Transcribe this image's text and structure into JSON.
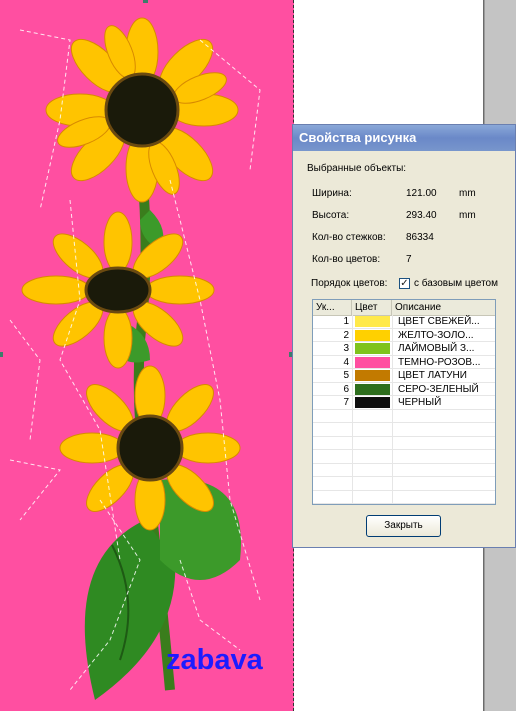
{
  "watermark": "zabava",
  "dialog": {
    "title": "Свойства рисунка",
    "selected_objects_label": "Выбранные объекты:",
    "width_label": "Ширина:",
    "width_value": "121.00",
    "width_unit": "mm",
    "height_label": "Высота:",
    "height_value": "293.40",
    "height_unit": "mm",
    "stitches_label": "Кол-во стежков:",
    "stitches_value": "86334",
    "colors_label": "Кол-во цветов:",
    "colors_value": "7",
    "order_label": "Порядок цветов:",
    "base_color_label": "с базовым цветом",
    "base_color_checked": "✓",
    "table": {
      "col_num": "Ук...",
      "col_color": "Цвет",
      "col_desc": "Описание",
      "rows": [
        {
          "num": "1",
          "color": "#ffe94a",
          "desc": "ЦВЕТ СВЕЖЕЙ..."
        },
        {
          "num": "2",
          "color": "#ffd000",
          "desc": "ЖЕЛТО-ЗОЛО..."
        },
        {
          "num": "3",
          "color": "#7fc31c",
          "desc": "ЛАЙМОВЫЙ З..."
        },
        {
          "num": "4",
          "color": "#ff4fa1",
          "desc": "ТЕМНО-РОЗОВ..."
        },
        {
          "num": "5",
          "color": "#c27a00",
          "desc": "ЦВЕТ ЛАТУНИ"
        },
        {
          "num": "6",
          "color": "#2e6e1e",
          "desc": "СЕРО-ЗЕЛЕНЫЙ"
        },
        {
          "num": "7",
          "color": "#0f0f0f",
          "desc": "ЧЕРНЫЙ"
        }
      ]
    },
    "close_button": "Закрыть"
  }
}
